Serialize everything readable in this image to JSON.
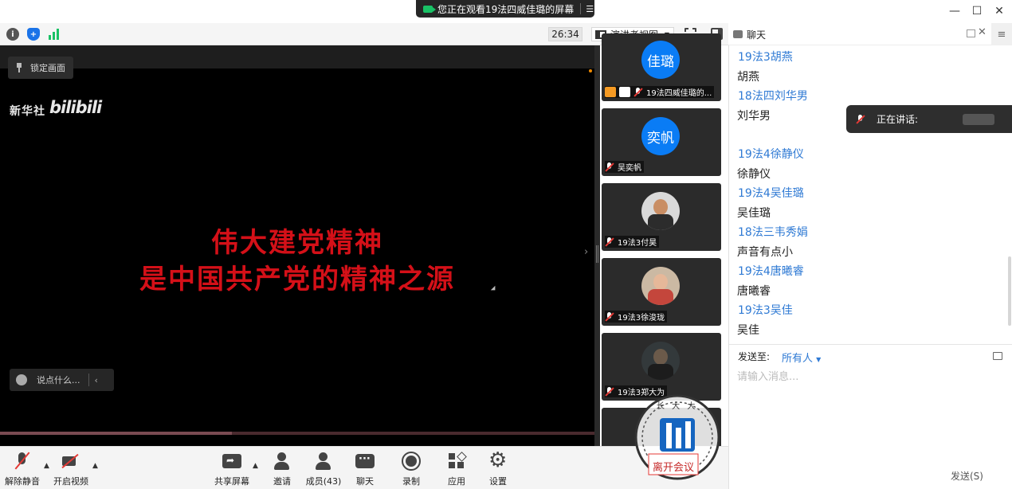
{
  "window": {
    "share_banner": "您正在观看19法四威佳璐的屏幕",
    "controls": [
      "—",
      "☐",
      "✕"
    ]
  },
  "toolbar": {
    "timer": "26:34",
    "view_mode": "演讲者视图",
    "info_color": "#555555",
    "shield_color": "#1a73e8",
    "signal_color": "#19c165"
  },
  "stage": {
    "lock_label": "锁定画面",
    "watermark_source": "新华社",
    "watermark_brand": "bilibili",
    "headline_line1": "伟大建党精神",
    "headline_line2": "是中国共产党的精神之源",
    "headline_color": "#d41018",
    "comment_placeholder": "说点什么...",
    "progress": 0.39
  },
  "participants": [
    {
      "avatar_text": "佳璐",
      "name": "19法四威佳璐的...",
      "presenter": true
    },
    {
      "avatar_text": "奕帆",
      "name": "吴奕帆"
    },
    {
      "avatar_text": "",
      "name": "19法3付昊"
    },
    {
      "avatar_text": "",
      "name": "19法3徐浚珑"
    },
    {
      "avatar_text": "",
      "name": "19法3郑大为"
    }
  ],
  "controls": {
    "unmute": "解除静音",
    "start_video": "开启视频",
    "share_screen": "共享屏幕",
    "invite": "邀请",
    "members": "成员(43)",
    "chat": "聊天",
    "record": "录制",
    "apps": "应用",
    "settings": "设置"
  },
  "chat": {
    "title": "聊天",
    "messages": [
      {
        "sender": "19法3胡燕",
        "text": "胡燕"
      },
      {
        "sender": "18法四刘华男",
        "text": "刘华男"
      },
      {
        "sender": "19法4徐静仪",
        "text": "徐静仪"
      },
      {
        "sender": "19法4吴佳璐",
        "text": "吴佳璐"
      },
      {
        "sender": "18法三韦秀娟",
        "text": "声音有点小"
      },
      {
        "sender": "19法4唐曦睿",
        "text": "唐曦睿"
      },
      {
        "sender": "19法3吴佳",
        "text": "吴佳"
      }
    ],
    "send_to_label": "发送至:",
    "send_to_value": "所有人",
    "input_placeholder": "请输入消息...",
    "speaking_label": "正在讲话:",
    "footer_hint": "发送(S)"
  },
  "stamp": {
    "top_text": "长 大 大",
    "bottom_text": "离开会议",
    "color": "#c62828"
  }
}
